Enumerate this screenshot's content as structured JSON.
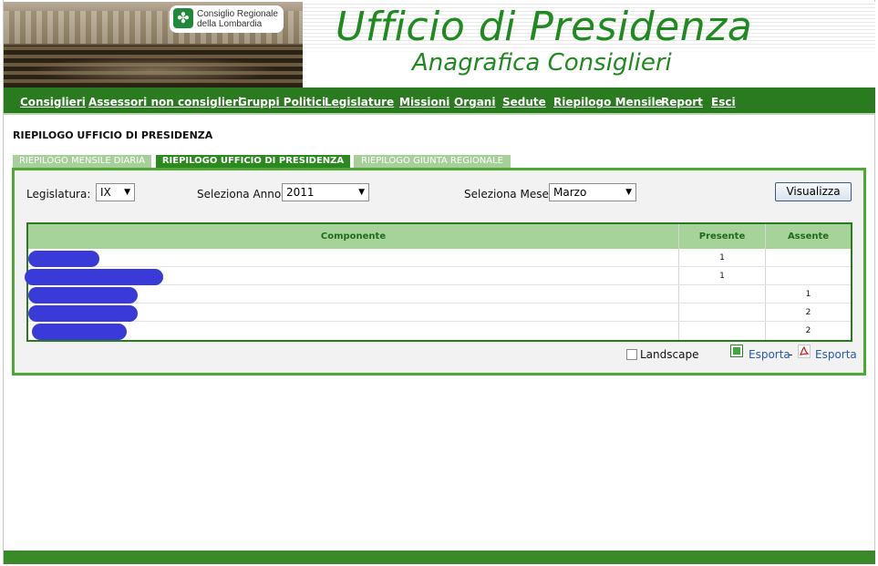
{
  "header": {
    "logo_line1": "Consiglio Regionale",
    "logo_line2": "della Lombardia",
    "title": "Ufficio di Presidenza",
    "subtitle": "Anagrafica Consiglieri",
    "logo_icon": "clover-icon"
  },
  "nav": {
    "items": [
      "Consiglieri",
      "Assessori non consiglieri",
      "Gruppi Politici",
      "Legislature",
      "Missioni",
      "Organi",
      "Sedute",
      "Riepilogo Mensile",
      "Report",
      "Esci"
    ]
  },
  "page": {
    "heading": "RIEPILOGO UFFICIO DI PRESIDENZA",
    "tabs": [
      {
        "label": "RIEPILOGO MENSILE DIARIA",
        "active": false
      },
      {
        "label": "RIEPILOGO UFFICIO DI PRESIDENZA",
        "active": true
      },
      {
        "label": "RIEPILOGO GIUNTA REGIONALE",
        "active": false
      }
    ]
  },
  "filters": {
    "legislatura_label": "Legislatura:",
    "legislatura_value": "IX",
    "anno_label": "Seleziona Anno:",
    "anno_value": "2011",
    "mese_label": "Seleziona Mese:",
    "mese_value": "Marzo",
    "submit_label": "Visualizza"
  },
  "table": {
    "columns": [
      "Componente",
      "Presente",
      "Assente"
    ],
    "rows": [
      {
        "componente": "",
        "presente": "1",
        "assente": ""
      },
      {
        "componente": "",
        "presente": "1",
        "assente": ""
      },
      {
        "componente": "",
        "presente": "",
        "assente": "1"
      },
      {
        "componente": "",
        "presente": "",
        "assente": "2"
      },
      {
        "componente": "",
        "presente": "",
        "assente": "2"
      }
    ]
  },
  "export": {
    "landscape_label": "Landscape",
    "landscape_checked": false,
    "excel_label": "Esporta",
    "separator": "-",
    "pdf_label": "Esporta",
    "excel_icon": "excel-icon",
    "pdf_icon": "pdf-icon"
  },
  "colors": {
    "brand_green": "#2a7a1f",
    "title_green": "#1f8a1f",
    "header_row": "#a6d39a",
    "redaction": "#3a3ad8"
  }
}
